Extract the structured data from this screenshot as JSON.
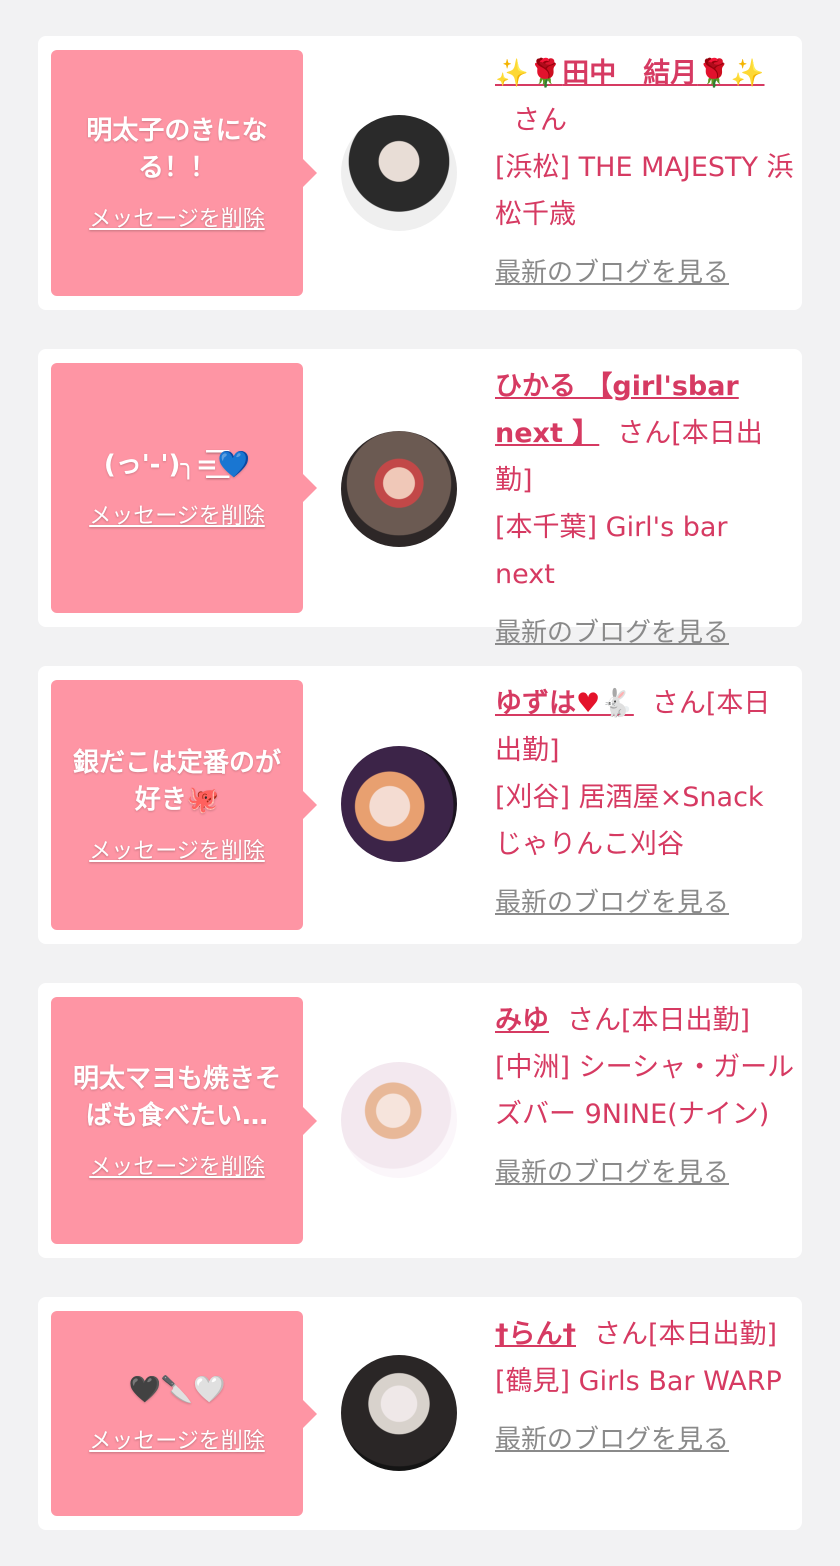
{
  "delete_label": "メッセージを削除",
  "blog_label": "最新のブログを見る",
  "san_label": "さん",
  "items": [
    {
      "message": "明太子のきになる！！",
      "name_prefix": "✨🌹",
      "name": "田中　結月",
      "name_suffix": "🌹✨",
      "status": "",
      "shop": "[浜松] THE MAJESTY 浜松千歳"
    },
    {
      "message": "(っ'-')╮=͟͟͞͞💙",
      "name_prefix": "",
      "name": "ひかる 【girl'sbar next 】",
      "name_suffix": "",
      "status": "[本日出勤]",
      "shop": "[本千葉] Girl's bar next"
    },
    {
      "message": "銀だこは定番のが好き🐙",
      "name_prefix": "",
      "name": "ゆずは",
      "name_suffix": "♥🐇",
      "status": "[本日出勤]",
      "shop": "[刈谷] 居酒屋×Snack じゃりんこ刈谷"
    },
    {
      "message": "明太マヨも焼きそばも食べたい…",
      "name_prefix": "",
      "name": "みゆ",
      "name_suffix": "",
      "status": "[本日出勤]",
      "shop": "[中洲] シーシャ・ガールズバー 9NINE(ナイン)"
    },
    {
      "message": "🖤🔪🤍",
      "name_prefix": "",
      "name": "†らん†",
      "name_suffix": "",
      "status": "[本日出勤]",
      "shop": "[鶴見] Girls Bar WARP"
    }
  ]
}
